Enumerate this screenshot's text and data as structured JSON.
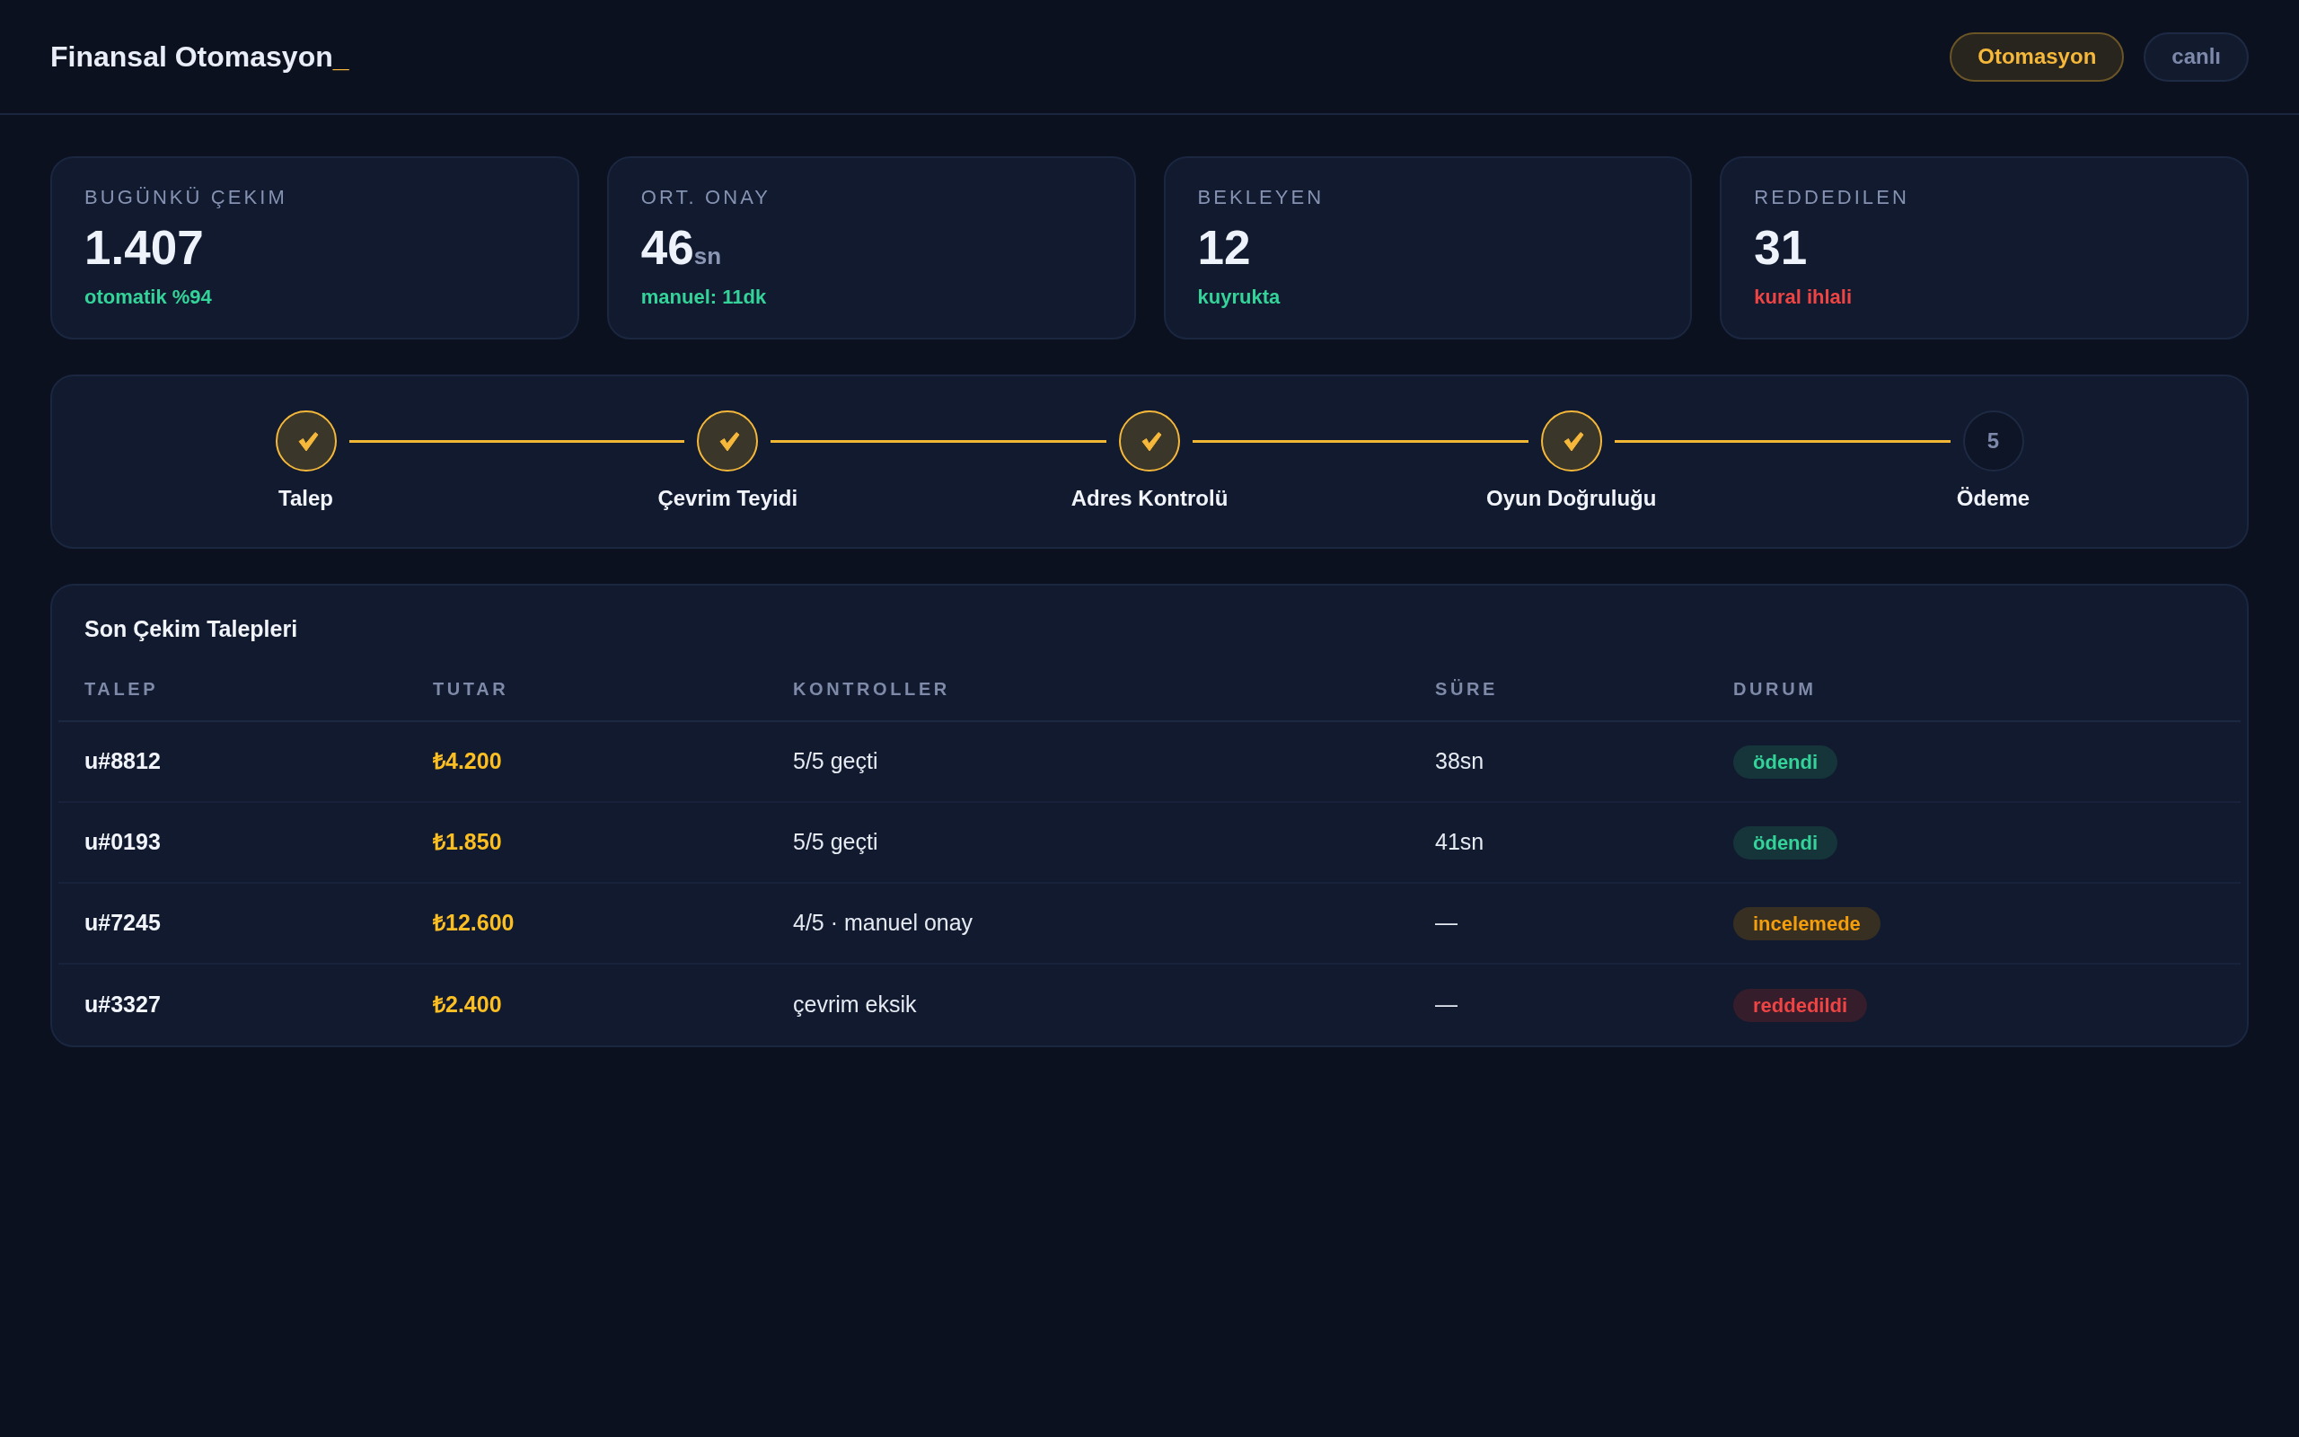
{
  "header": {
    "title": "Finansal Otomasyon",
    "cursor": "_",
    "toggles": [
      {
        "label": "Otomasyon",
        "selected": true
      },
      {
        "label": "canlı",
        "selected": false
      }
    ]
  },
  "stats": [
    {
      "label": "BUGÜNKÜ ÇEKIM",
      "value": "1.407",
      "note": {
        "text": "otomatik %94",
        "color": "#34d399"
      }
    },
    {
      "label": "ORT. ONAY",
      "value": "46",
      "unit": "sn",
      "note": {
        "text": "manuel: 11dk",
        "color": "#34d399"
      }
    },
    {
      "label": "BEKLEYEN",
      "value": "12",
      "note": {
        "text": "kuyrukta",
        "color": "#34d399"
      }
    },
    {
      "label": "REDDEDILEN",
      "value": "31",
      "note": {
        "text": "kural ihlali",
        "color": "#ef4444"
      }
    }
  ],
  "pipeline": {
    "steps": [
      {
        "label": "Talep",
        "completed": true
      },
      {
        "label": "Çevrim Teyidi",
        "completed": true
      },
      {
        "label": "Adres Kontrolü",
        "completed": true
      },
      {
        "label": "Oyun Doğruluğu",
        "completed": true
      },
      {
        "label": "Ödeme",
        "completed": false,
        "number": "5"
      }
    ]
  },
  "requests": {
    "title": "Son Çekim Talepleri",
    "columns": [
      "TALEP",
      "TUTAR",
      "KONTROLLER",
      "SÜRE",
      "DURUM"
    ],
    "rows": [
      {
        "id": "u#8812",
        "amount": "₺4.200",
        "checks": "5/5 geçti",
        "duration": "38sn",
        "status": {
          "text": "ödendi",
          "kind": "paid"
        }
      },
      {
        "id": "u#0193",
        "amount": "₺1.850",
        "checks": "5/5 geçti",
        "duration": "41sn",
        "status": {
          "text": "ödendi",
          "kind": "paid"
        }
      },
      {
        "id": "u#7245",
        "amount": "₺12.600",
        "checks": "4/5 · manuel onay",
        "duration": "—",
        "status": {
          "text": "incelemede",
          "kind": "review"
        }
      },
      {
        "id": "u#3327",
        "amount": "₺2.400",
        "checks": "çevrim eksik",
        "duration": "—",
        "status": {
          "text": "reddedildi",
          "kind": "rejected"
        }
      }
    ]
  }
}
